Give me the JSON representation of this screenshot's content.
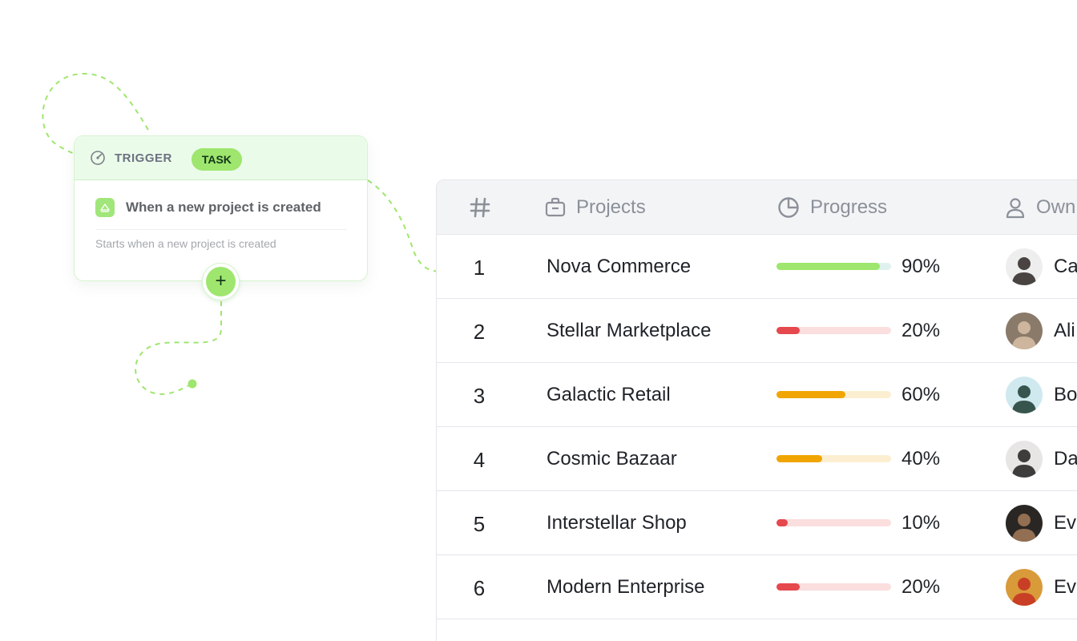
{
  "trigger": {
    "label": "TRIGGER",
    "badge": "TASK",
    "event_title": "When a new project is created",
    "event_description": "Starts when a new project is created",
    "add_step_symbol": "+",
    "accent_color": "#9ee66e"
  },
  "table": {
    "headers": {
      "number": "#",
      "projects": "Projects",
      "progress": "Progress",
      "owner": "Own"
    },
    "rows": [
      {
        "number": "1",
        "project": "Nova Commerce",
        "progress": 0.9,
        "progress_label": "90%",
        "bar_color": "#9ee66e",
        "track_color": "#dff2f0",
        "owner": "Ca",
        "avatar_bg": "#eeeeee",
        "avatar_fg": "#2b2522"
      },
      {
        "number": "2",
        "project": "Stellar Marketplace",
        "progress": 0.2,
        "progress_label": "20%",
        "bar_color": "#e5484d",
        "track_color": "#fbdede",
        "owner": "Ali",
        "avatar_bg": "#8a7a6a",
        "avatar_fg": "#d8c1a6"
      },
      {
        "number": "3",
        "project": "Galactic Retail",
        "progress": 0.6,
        "progress_label": "60%",
        "bar_color": "#f0a500",
        "track_color": "#fcefd1",
        "owner": "Bo",
        "avatar_bg": "#cfe9ef",
        "avatar_fg": "#1d3b30"
      },
      {
        "number": "4",
        "project": "Cosmic Bazaar",
        "progress": 0.4,
        "progress_label": "40%",
        "bar_color": "#f0a500",
        "track_color": "#fcefd1",
        "owner": "Da",
        "avatar_bg": "#e8e6e4",
        "avatar_fg": "#1e1e1e"
      },
      {
        "number": "5",
        "project": "Interstellar Shop",
        "progress": 0.1,
        "progress_label": "10%",
        "bar_color": "#e5484d",
        "track_color": "#fbdede",
        "owner": "Eva",
        "avatar_bg": "#2a2624",
        "avatar_fg": "#a47b5b"
      },
      {
        "number": "6",
        "project": "Modern Enterprise",
        "progress": 0.2,
        "progress_label": "20%",
        "bar_color": "#e5484d",
        "track_color": "#fbdede",
        "owner": "Eva",
        "avatar_bg": "#d99a3a",
        "avatar_fg": "#c62f22"
      }
    ]
  }
}
